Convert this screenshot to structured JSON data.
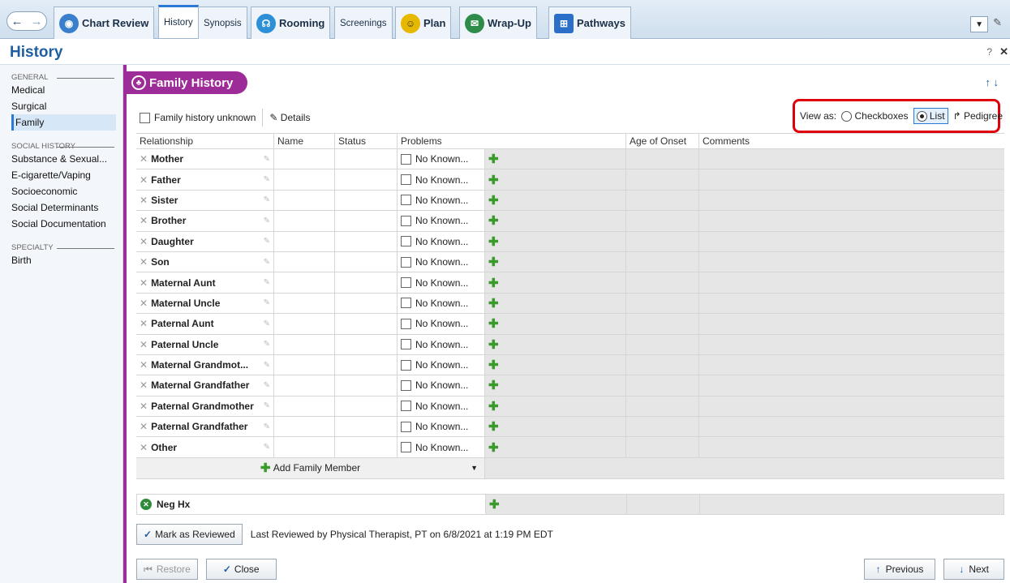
{
  "tabs": [
    {
      "label": "Chart Review",
      "icon": "chart-review-icon",
      "color": "#3a7fcc"
    },
    {
      "label": "History",
      "icon": "",
      "color": ""
    },
    {
      "label": "Synopsis",
      "icon": "",
      "color": ""
    },
    {
      "label": "Rooming",
      "icon": "stethoscope-icon",
      "color": "#2d8fd6"
    },
    {
      "label": "Screenings",
      "icon": "",
      "color": ""
    },
    {
      "label": "Plan",
      "icon": "plan-icon",
      "color": "#e6b800"
    },
    {
      "label": "Wrap-Up",
      "icon": "wrap-up-icon",
      "color": "#2e8b4a"
    },
    {
      "label": "Pathways",
      "icon": "pathways-icon",
      "color": "#2b6fc8"
    }
  ],
  "activity": {
    "title": "History"
  },
  "sidebar": {
    "groups": [
      {
        "label": "GENERAL",
        "items": [
          "Medical",
          "Surgical",
          "Family"
        ]
      },
      {
        "label": "SOCIAL HISTORY",
        "items": [
          "Substance & Sexual...",
          "E-cigarette/Vaping",
          "Socioeconomic",
          "Social Determinants",
          "Social Documentation"
        ]
      },
      {
        "label": "SPECIALTY",
        "items": [
          "Birth"
        ]
      }
    ],
    "active": "Family"
  },
  "section": {
    "title": "Family History",
    "accent": "#9d2c98"
  },
  "options": {
    "unknown_label": "Family history unknown",
    "details_label": "Details",
    "view_as_label": "View as:",
    "checkboxes_label": "Checkboxes",
    "list_label": "List",
    "pedigree_label": "Pedigree",
    "selected_view": "List"
  },
  "grid": {
    "headers": [
      "Relationship",
      "Name",
      "Status",
      "Problems",
      "Age of Onset",
      "Comments"
    ],
    "no_known_label": "No Known...",
    "rows": [
      "Mother",
      "Father",
      "Sister",
      "Brother",
      "Daughter",
      "Son",
      "Maternal Aunt",
      "Maternal Uncle",
      "Paternal Aunt",
      "Paternal Uncle",
      "Maternal Grandmot...",
      "Maternal Grandfather",
      "Paternal Grandmother",
      "Paternal Grandfather",
      "Other"
    ],
    "add_label": "Add Family Member"
  },
  "neg_hx": {
    "label": "Neg Hx"
  },
  "review": {
    "button_label": "Mark as Reviewed",
    "status_text": "Last Reviewed by Physical Therapist, PT on 6/8/2021 at 1:19 PM EDT"
  },
  "footer": {
    "restore_label": "Restore",
    "close_label": "Close",
    "previous_label": "Previous",
    "next_label": "Next"
  }
}
